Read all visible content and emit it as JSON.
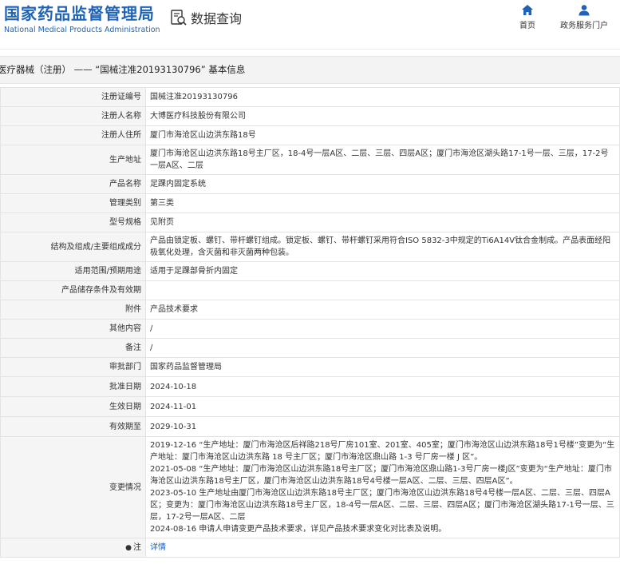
{
  "header": {
    "brand_cn": "国家药品监督管理局",
    "brand_en": "National Medical Products Administration",
    "query_label": "数据查询",
    "nav": [
      {
        "label": "首页"
      },
      {
        "label": "政务服务门户"
      }
    ]
  },
  "titlebar": {
    "text": "医疗器械（注册） —— “国械注准20193130796” 基本信息"
  },
  "colors": {
    "brand": "#1f63b8",
    "label_bg": "#f5f5f5",
    "border": "#e3e3e3"
  },
  "rows": [
    {
      "label": "注册证编号",
      "value": "国械注准20193130796"
    },
    {
      "label": "注册人名称",
      "value": "大博医疗科技股份有限公司"
    },
    {
      "label": "注册人住所",
      "value": "厦门市海沧区山边洪东路18号"
    },
    {
      "label": "生产地址",
      "value": "厦门市海沧区山边洪东路18号主厂区，18-4号一层A区、二层、三层、四层A区；厦门市海沧区湖头路17-1号一层、三层，17-2号一层A区、二层"
    },
    {
      "label": "产品名称",
      "value": "足踝内固定系统"
    },
    {
      "label": "管理类别",
      "value": "第三类"
    },
    {
      "label": "型号规格",
      "value": "见附页"
    },
    {
      "label": "结构及组成/主要组成成分",
      "value": "产品由锁定板、螺钉、带杆螺钉组成。锁定板、螺钉、带杆螺钉采用符合ISO 5832-3中规定的Ti6A14V钛合金制成。产品表面经阳极氧化处理，含灭菌和非灭菌两种包装。"
    },
    {
      "label": "适用范围/预期用途",
      "value": "适用于足踝部骨折内固定"
    },
    {
      "label": "产品储存条件及有效期",
      "value": ""
    },
    {
      "label": "附件",
      "value": "产品技术要求"
    },
    {
      "label": "其他内容",
      "value": "/"
    },
    {
      "label": "备注",
      "value": "/"
    },
    {
      "label": "审批部门",
      "value": "国家药品监督管理局"
    },
    {
      "label": "批准日期",
      "value": "2024-10-18"
    },
    {
      "label": "生效日期",
      "value": "2024-11-01"
    },
    {
      "label": "有效期至",
      "value": "2029-10-31"
    }
  ],
  "changes": {
    "label": "变更情况",
    "lines": [
      "2019-12-16 “生产地址：厦门市海沧区后祥路218号厂房101室、201室、405室；厦门市海沧区山边洪东路18号1号楼”变更为“生产地址：厦门市海沧区山边洪东路 18 号主厂区；厦门市海沧区鼎山路 1-3 号厂房一楼 J 区”。",
      "2021-05-08 “生产地址：厦门市海沧区山边洪东路18号主厂区；厦门市海沧区鼎山路1-3号厂房一楼J区”变更为“生产地址：厦门市海沧区山边洪东路18号主厂区，厦门市海沧区山边洪东路18号4号楼一层A区、二层、三层、四层A区”。",
      "2023-05-10 生产地址由厦门市海沧区山边洪东路18号主厂区；厦门市海沧区山边洪东路18号4号楼一层A区、二层、三层、四层A区；变更为：厦门市海沧区山边洪东路18号主厂区，18-4号一层A区、二层、三层、四层A区；厦门市海沧区湖头路17-1号一层、三层，17-2号一层A区、二层",
      "2024-08-16 申请人申请变更产品技术要求，详见产品技术要求变化对比表及说明。"
    ]
  },
  "note": {
    "label": "注",
    "link": "详情"
  }
}
